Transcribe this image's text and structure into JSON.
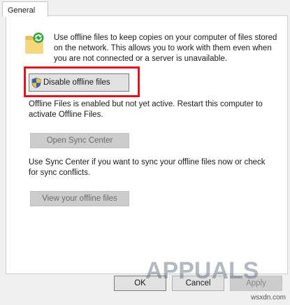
{
  "tabs": [
    {
      "label": "General",
      "selected": true
    }
  ],
  "info": {
    "icon": "offline-files-sync-icon",
    "lines": [
      "Use offline files to keep copies on your computer of files stored",
      "on the network.  This allows you to work with them even when",
      "you are not connected or a server is unavailable."
    ]
  },
  "disable_button": {
    "label": "Disable offline files",
    "icon": "uac-shield-icon"
  },
  "annotation": {
    "color": "#e0141b"
  },
  "status": {
    "lines": [
      "Offline Files is enabled but not yet active.  Restart this computer to",
      "activate Offline Files."
    ]
  },
  "sync_center_button": {
    "label": "Open Sync Center",
    "enabled": false
  },
  "sync_text": {
    "lines": [
      "Use Sync Center if you want to sync your offline files now or check",
      "for sync conflicts."
    ]
  },
  "view_files_button": {
    "label": "View your offline files",
    "enabled": false
  },
  "footer": {
    "ok_label": "OK",
    "cancel_label": "Cancel",
    "apply_label": "Apply",
    "apply_enabled": false
  },
  "watermark": {
    "text": "APPUALS",
    "domain": "wsxdn.com"
  }
}
